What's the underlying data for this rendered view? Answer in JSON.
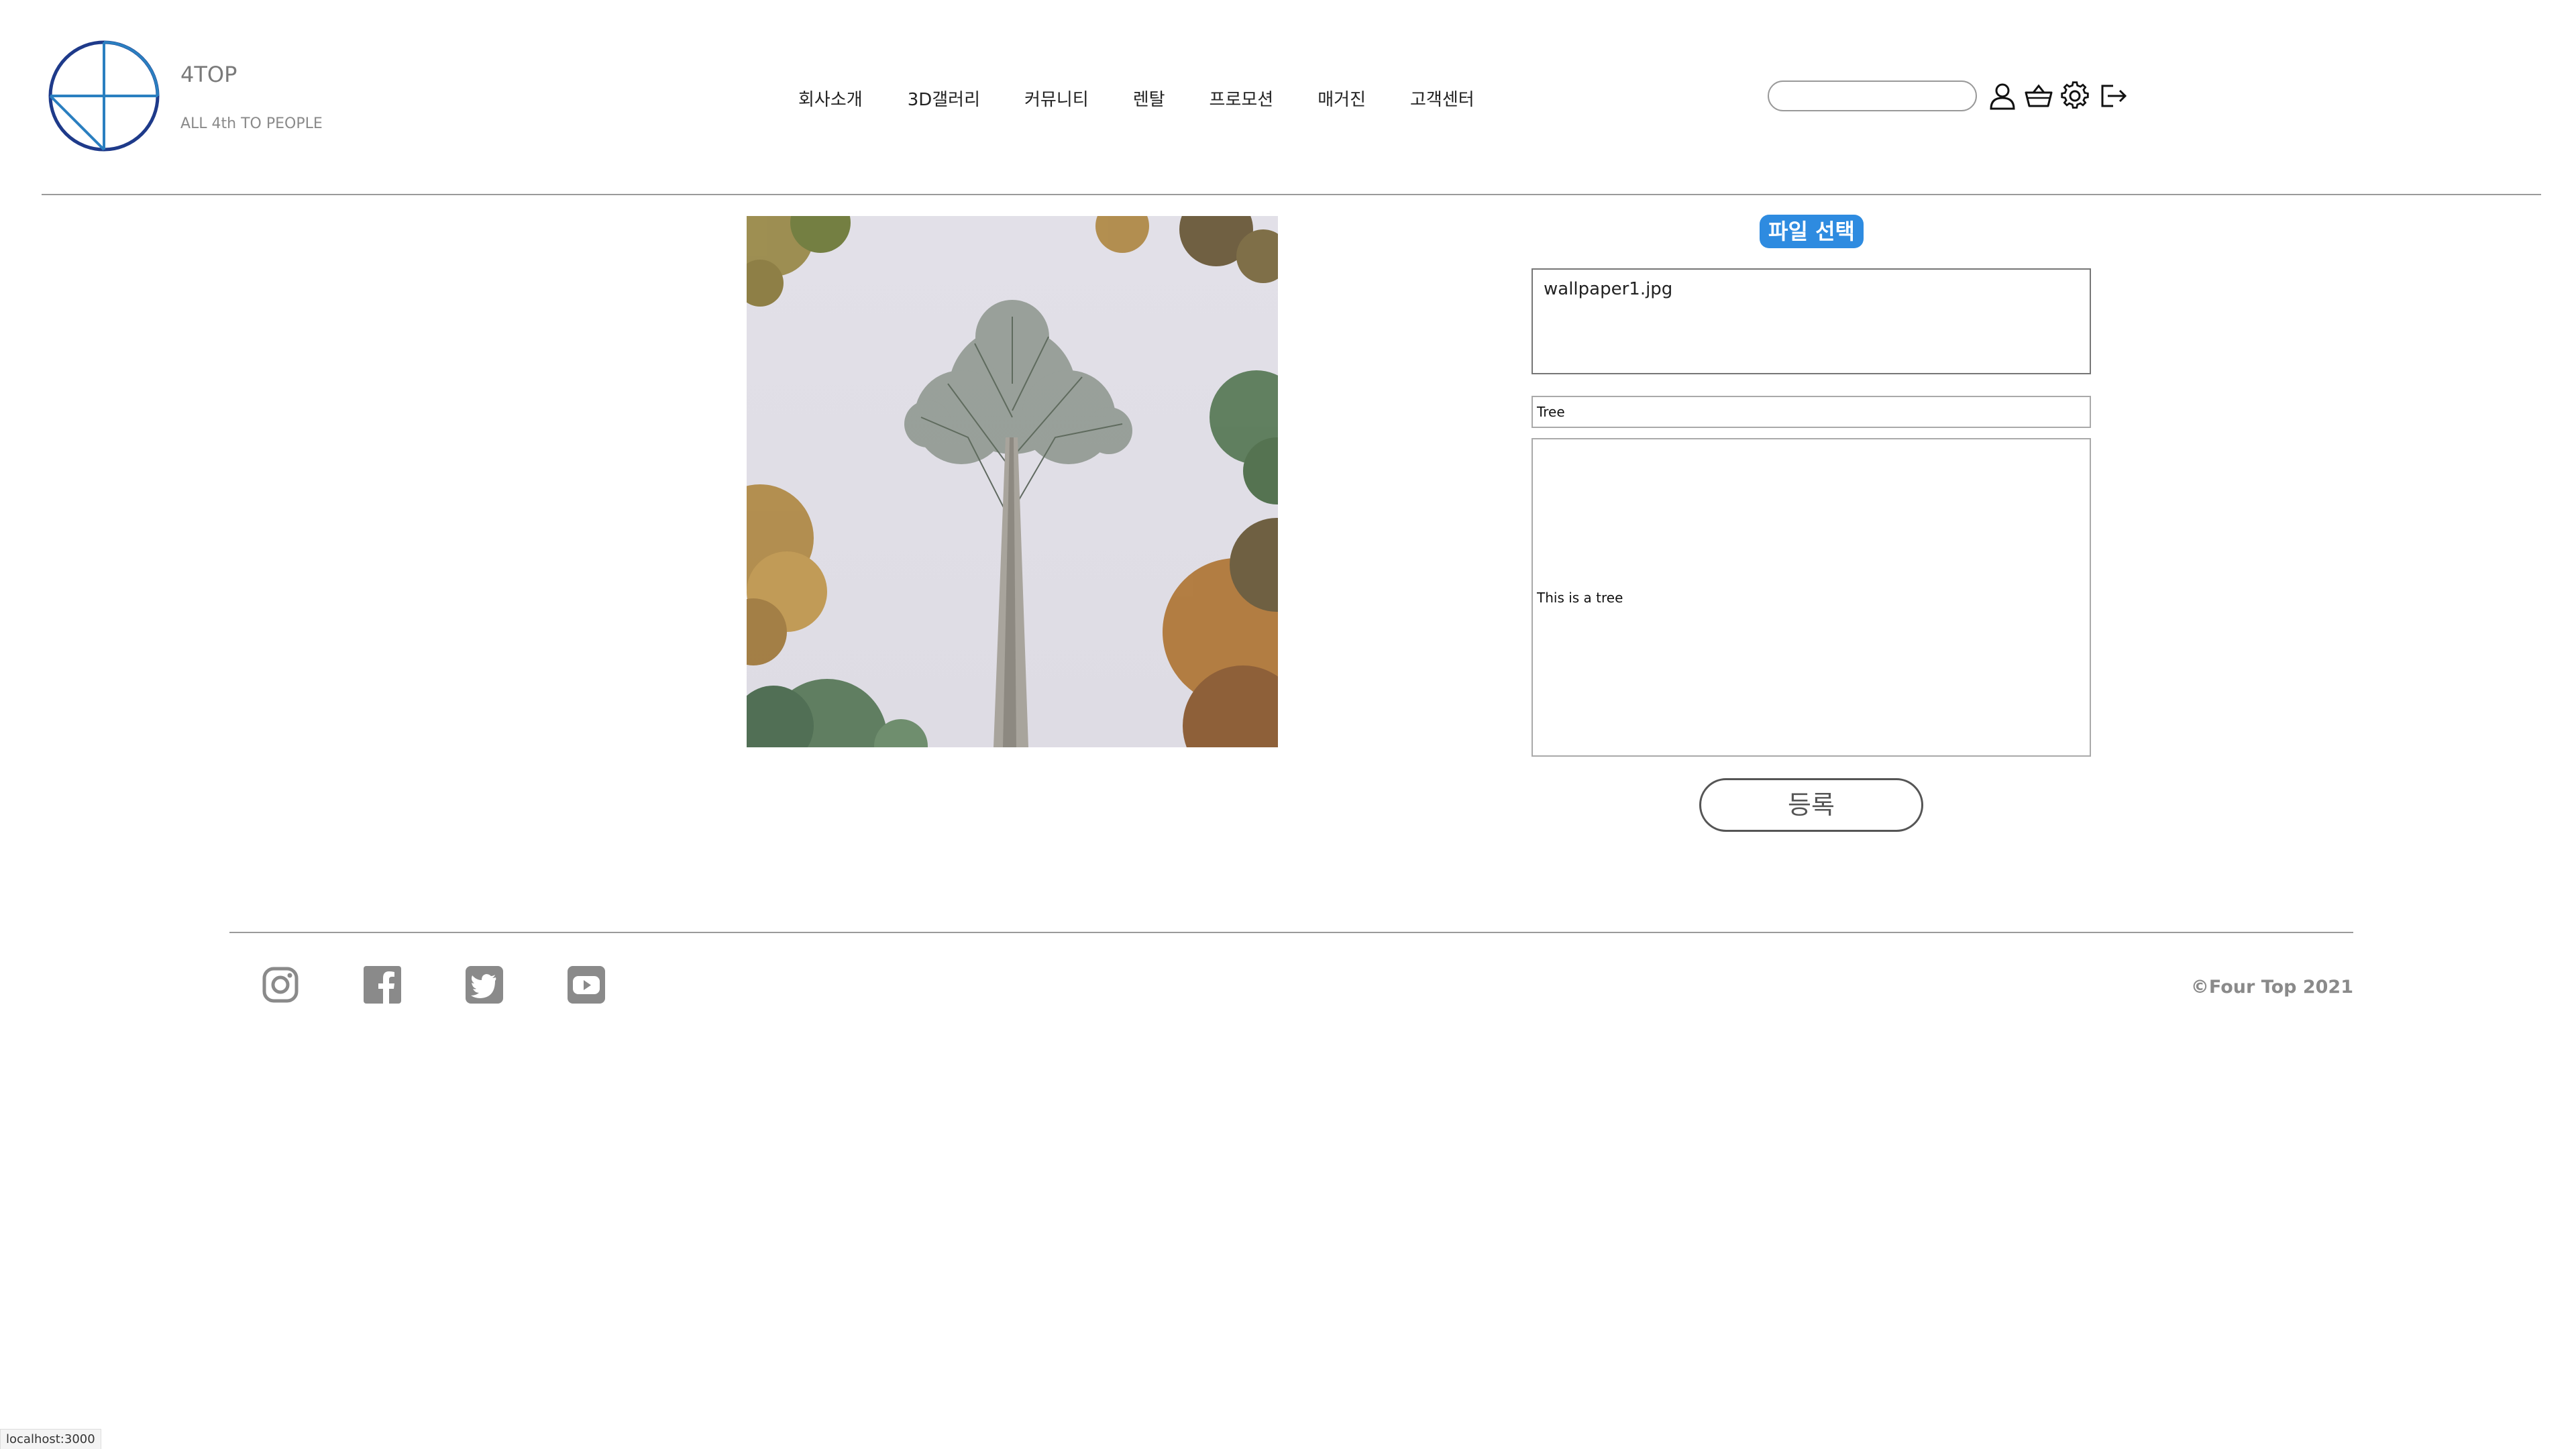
{
  "brand": {
    "name": "4TOP",
    "tagline": "ALL 4th TO PEOPLE",
    "logo_icon": "globe-logo-icon",
    "logo_color": "#1e3a8a"
  },
  "nav": {
    "items": [
      {
        "label": "회사소개"
      },
      {
        "label": "3D갤러리"
      },
      {
        "label": "커뮤니티"
      },
      {
        "label": "렌탈"
      },
      {
        "label": "프로모션"
      },
      {
        "label": "매거진"
      },
      {
        "label": "고객센터"
      }
    ]
  },
  "header": {
    "search_value": "",
    "icons": [
      "user-icon",
      "basket-icon",
      "gear-icon",
      "logout-icon"
    ]
  },
  "upload": {
    "file_button_label": "파일 선택",
    "file_button_color": "#2e8be0",
    "file_name": "wallpaper1.jpg",
    "title_value": "Tree",
    "description_value": "This is a tree",
    "submit_label": "등록",
    "preview_image": "tree-photo"
  },
  "footer": {
    "social_icons": [
      "instagram-icon",
      "facebook-icon",
      "twitter-icon",
      "youtube-icon"
    ],
    "copyright": "©Four Top 2021"
  },
  "status_bar": {
    "url": "localhost:3000"
  }
}
